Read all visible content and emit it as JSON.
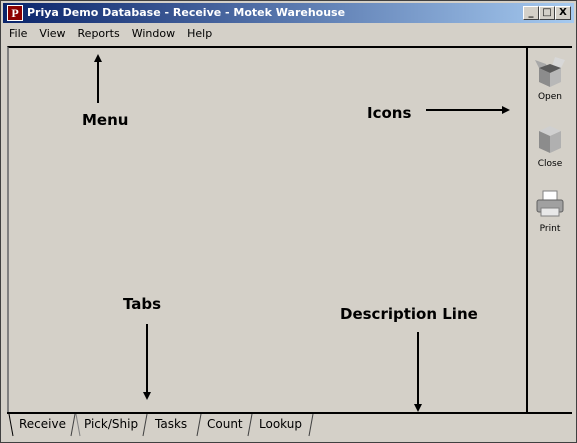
{
  "window": {
    "title": "Priya Demo Database - Receive - Motek Warehouse",
    "icon_letter": "P",
    "buttons": {
      "minimize": "_",
      "maximize": "□",
      "close": "X"
    }
  },
  "menu": [
    "File",
    "View",
    "Reports",
    "Window",
    "Help"
  ],
  "toolbar": [
    {
      "label": "Open",
      "icon": "open-box-icon"
    },
    {
      "label": "Close",
      "icon": "closed-box-icon"
    },
    {
      "label": "Print",
      "icon": "printer-icon"
    }
  ],
  "tabs": [
    "Receive",
    "Pick/Ship",
    "Tasks",
    "Count",
    "Lookup"
  ],
  "active_tab": "Receive",
  "annotations": {
    "menu": "Menu",
    "icons": "Icons",
    "tabs": "Tabs",
    "description_line": "Description Line"
  }
}
